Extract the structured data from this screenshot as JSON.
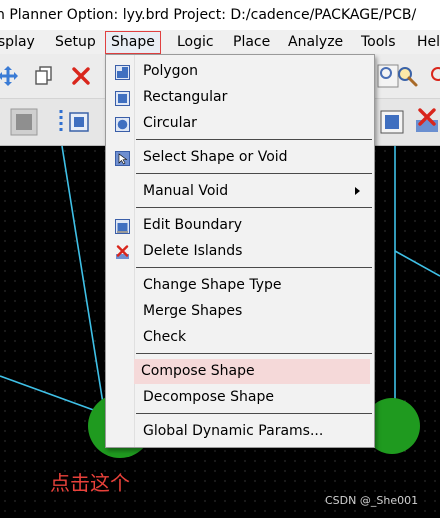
{
  "window": {
    "title": "n Planner Option: lyy.brd  Project: D:/cadence/PACKAGE/PCB/"
  },
  "menubar": {
    "items": [
      {
        "label": "isplay"
      },
      {
        "label": "Setup"
      },
      {
        "label": "Shape"
      },
      {
        "label": "Logic"
      },
      {
        "label": "Place"
      },
      {
        "label": "Analyze"
      },
      {
        "label": "Tools"
      },
      {
        "label": "Help"
      }
    ]
  },
  "shape_menu": {
    "items": [
      {
        "label": "Polygon",
        "icon": "polygon-icon"
      },
      {
        "label": "Rectangular",
        "icon": "rectangle-icon"
      },
      {
        "label": "Circular",
        "icon": "circle-icon"
      },
      {
        "label": "Select Shape or Void",
        "icon": "select-shape-icon"
      },
      {
        "label": "Manual Void",
        "has_submenu": true
      },
      {
        "label": "Edit Boundary",
        "icon": "edit-boundary-icon"
      },
      {
        "label": "Delete Islands",
        "icon": "delete-islands-icon"
      },
      {
        "label": "Change Shape Type"
      },
      {
        "label": "Merge Shapes"
      },
      {
        "label": "Check"
      },
      {
        "label": "Compose Shape",
        "highlighted": true
      },
      {
        "label": "Decompose Shape"
      },
      {
        "label": "Global Dynamic Params..."
      }
    ]
  },
  "annotation": {
    "text": "点击这个"
  },
  "watermark": {
    "text": "CSDN @_She001"
  },
  "colors": {
    "highlight": "#f5d9d9",
    "selected_border": "#e04040",
    "annotation": "#e8413a",
    "trace": "#3fc0e6",
    "pad": "#1f9a1f"
  }
}
